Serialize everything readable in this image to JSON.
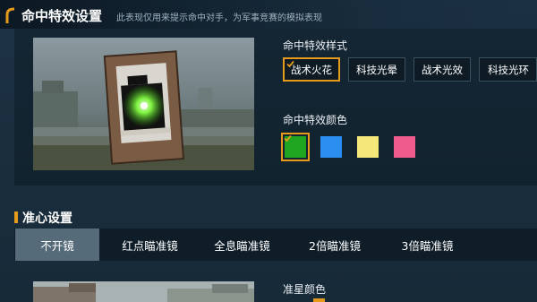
{
  "header": {
    "title": "命中特效设置",
    "subtitle": "此表现仅用来提示命中对手，为军事竞赛的模拟表现"
  },
  "hit_effect": {
    "style_label": "命中特效样式",
    "styles": [
      {
        "label": "战术火花",
        "selected": true
      },
      {
        "label": "科技光晕",
        "selected": false
      },
      {
        "label": "战术光效",
        "selected": false
      },
      {
        "label": "科技光环",
        "selected": false
      }
    ],
    "color_label": "命中特效颜色",
    "colors": [
      {
        "hex": "#1fa51f",
        "selected": true
      },
      {
        "hex": "#2a8ff0",
        "selected": false
      },
      {
        "hex": "#f5e879",
        "selected": false
      },
      {
        "hex": "#ee5b8c",
        "selected": false
      }
    ]
  },
  "crosshair": {
    "title": "准心设置",
    "tabs": [
      {
        "label": "不开镜",
        "active": true
      },
      {
        "label": "红点瞄准镜",
        "active": false
      },
      {
        "label": "全息瞄准镜",
        "active": false
      },
      {
        "label": "2倍瞄准镜",
        "active": false
      },
      {
        "label": "3倍瞄准镜",
        "active": false
      }
    ],
    "color_label": "准星颜色"
  },
  "colors": {
    "accent": "#e59a1b",
    "selected_tab": "#556b7a"
  }
}
